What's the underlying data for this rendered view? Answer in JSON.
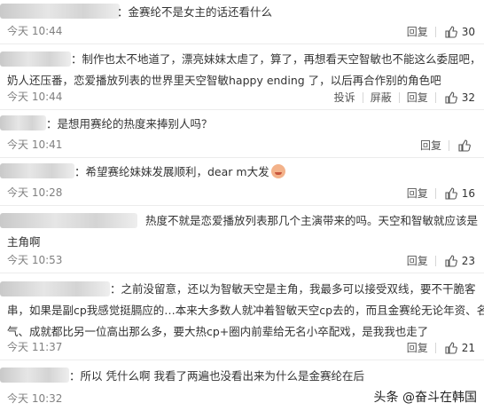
{
  "comments": [
    {
      "lines": [
        "：金赛纶不是女主的话还看什么"
      ],
      "time": "今天 10:44",
      "actions": [
        "回复"
      ],
      "likes": "30"
    },
    {
      "lines": [
        "：制作也太不地道了，漂亮妹妹太虐了，算了，再想看天空智敏也不能这么委屈吧，",
        "奶人还压番，恋爱播放列表的世界里天空智敏happy ending 了，以后再合作别的角色吧"
      ],
      "time": "今天 10:44",
      "actions": [
        "投诉",
        "屏蔽",
        "回复"
      ],
      "likes": "32"
    },
    {
      "lines": [
        "：是想用赛纶的热度来捧别人吗？"
      ],
      "time": "今天 10:41",
      "actions": [
        "回复"
      ],
      "likes": ""
    },
    {
      "lines": [
        "：希望赛纶妹妹发展顺利，dear m大发"
      ],
      "time": "今天 10:28",
      "actions": [
        "回复"
      ],
      "likes": "16"
    },
    {
      "lines": [
        "热度不就是恋爱播放列表那几个主演带来的吗。天空和智敏就应该是",
        "主角啊"
      ],
      "time": "今天 10:53",
      "actions": [
        "回复"
      ],
      "likes": "23"
    },
    {
      "lines": [
        "：之前没留意，还以为智敏天空是主角，我最多可以接受双线，要不干脆客",
        "串，如果是副cp我感觉挺膈应的…本来大多数人就冲着智敏天空cp去的，而且金赛纶无论年资、名",
        "气、成就都比另一位高出那么多，要大热cp+圈内前辈给无名小卒配戏，是我我也走了"
      ],
      "time": "今天 11:37",
      "actions": [
        "回复"
      ],
      "likes": "21"
    },
    {
      "lines": [
        "：所以 凭什么啊 我看了两遍也没看出来为什么是金赛纶在后"
      ],
      "time": "今天 10:32",
      "actions": [
        "回复"
      ],
      "likes": ""
    }
  ],
  "watermark": "头条 @奋斗在韩国"
}
